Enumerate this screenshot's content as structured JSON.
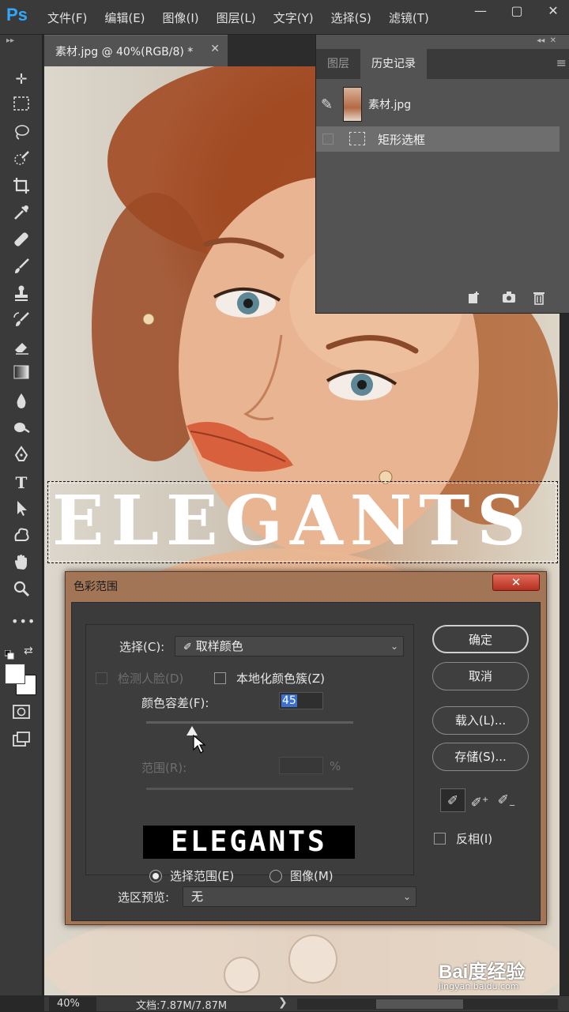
{
  "app": {
    "logo": "Ps"
  },
  "menu": [
    "文件(F)",
    "编辑(E)",
    "图像(I)",
    "图层(L)",
    "文字(Y)",
    "选择(S)",
    "滤镜(T)"
  ],
  "document": {
    "tab_title": "素材.jpg @ 40%(RGB/8) *",
    "canvas_text": "ELEGANTS"
  },
  "history_panel": {
    "tabs": [
      "图层",
      "历史记录"
    ],
    "active_tab": "历史记录",
    "snapshot_label": "素材.jpg",
    "state_label": "矩形选框"
  },
  "dialog": {
    "title": "色彩范围",
    "select_label": "选择(C):",
    "select_value": "取样颜色",
    "detect_faces_label": "检测人脸(D)",
    "localized_label": "本地化颜色簇(Z)",
    "fuzziness_label": "颜色容差(F):",
    "fuzziness_value": "45",
    "range_label": "范围(R):",
    "range_unit": "%",
    "preview_text": "ELEGANTS",
    "radio_selection": "选择范围(E)",
    "radio_image": "图像(M)",
    "preview_mode_label": "选区预览:",
    "preview_mode_value": "无",
    "buttons": {
      "ok": "确定",
      "cancel": "取消",
      "load": "载入(L)...",
      "save": "存储(S)..."
    },
    "invert_label": "反相(I)",
    "fuzziness_slider_fraction": 0.22
  },
  "status": {
    "zoom": "40%",
    "doc_info": "文档:7.87M/7.87M"
  },
  "watermark": {
    "text": "Bai度经验",
    "url": "jingyan.baidu.com"
  },
  "colors": {
    "accent": "#31a8ff",
    "dialog_frame": "#a27556",
    "close_button": "#c8402e"
  }
}
